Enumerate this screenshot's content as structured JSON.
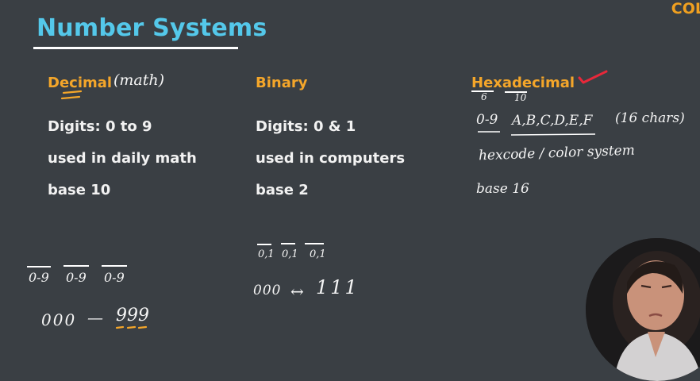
{
  "brand": "COL",
  "title": "Number Systems",
  "columns": {
    "decimal": {
      "heading": "Decimal",
      "note": "(math)",
      "digits": "Digits:  0 to 9",
      "usage": "used in daily math",
      "base": "base 10",
      "groups": [
        "0-9",
        "0-9",
        "0-9"
      ],
      "range_start": "000",
      "range_dash": "—",
      "range_end": "999"
    },
    "binary": {
      "heading": "Binary",
      "digits": "Digits:  0 & 1",
      "usage": "used in computers",
      "base": "base 2",
      "groups": [
        "0,1",
        "0,1",
        "0,1"
      ],
      "range_start": "000",
      "range_arrow": "↔",
      "range_end": "111"
    },
    "hexadecimal": {
      "heading": "Hexadecimal",
      "split_a": "6",
      "split_b": "10",
      "digits_hand": "0-9",
      "letters_hand": "A,B,C,D,E,F",
      "count_hand": "(16 chars)",
      "usage_hand": "hexcode / color system",
      "base_hand": "base 16"
    }
  },
  "colors": {
    "background": "#3a3f44",
    "title": "#54c8ea",
    "heading": "#f4a62a",
    "text": "#f2f2f2",
    "annotation_red": "#e8283a"
  }
}
